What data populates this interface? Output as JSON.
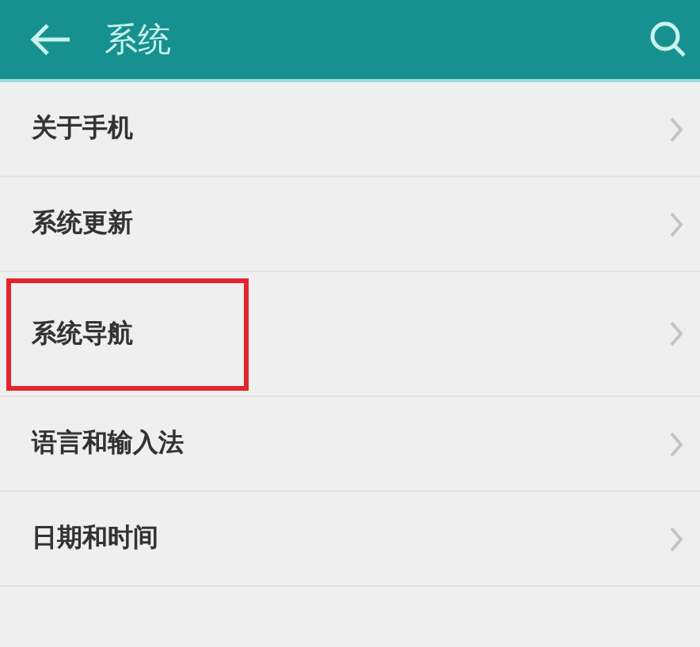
{
  "header": {
    "title": "系统"
  },
  "items": [
    {
      "label": "关于手机",
      "highlighted": false
    },
    {
      "label": "系统更新",
      "highlighted": false
    },
    {
      "label": "系统导航",
      "highlighted": true
    },
    {
      "label": "语言和输入法",
      "highlighted": false
    },
    {
      "label": "日期和时间",
      "highlighted": false
    }
  ]
}
